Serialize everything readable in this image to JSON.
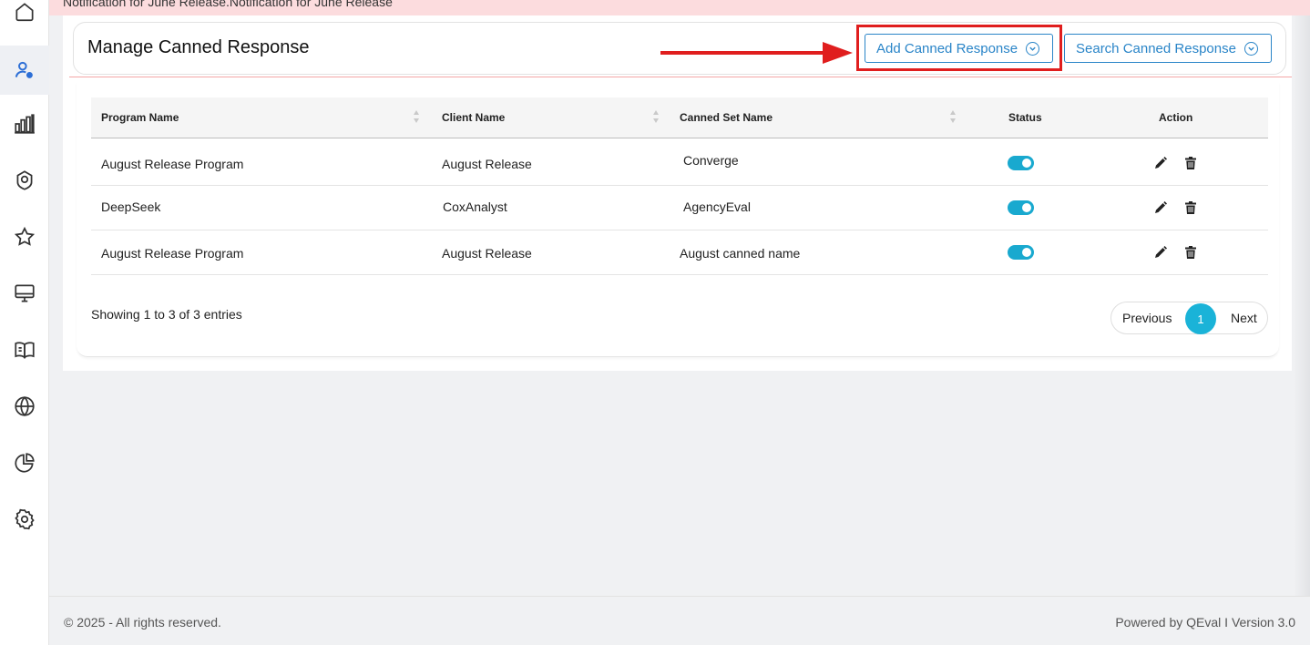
{
  "banner": {
    "text": "Notification for June Release.Notification for June Release"
  },
  "sidebar": {
    "items": [
      {
        "icon": "home-icon"
      },
      {
        "icon": "user-settings-icon",
        "active": true
      },
      {
        "icon": "bar-chart-icon"
      },
      {
        "icon": "badge-icon"
      },
      {
        "icon": "star-icon"
      },
      {
        "icon": "monitor-icon"
      },
      {
        "icon": "book-icon"
      },
      {
        "icon": "globe-icon"
      },
      {
        "icon": "pie-chart-icon"
      },
      {
        "icon": "gear-icon"
      }
    ]
  },
  "header": {
    "title": "Manage Canned Response",
    "add_button": "Add Canned Response",
    "search_button": "Search Canned Response"
  },
  "table": {
    "columns": [
      "Program Name",
      "Client Name",
      "Canned Set Name",
      "Status",
      "Action"
    ],
    "rows": [
      {
        "program": "August Release Program",
        "client": "August Release",
        "canned_set": "Converge",
        "status": "on"
      },
      {
        "program": "DeepSeek",
        "client": "CoxAnalyst",
        "canned_set": "AgencyEval",
        "status": "on"
      },
      {
        "program": "August Release Program",
        "client": "August Release",
        "canned_set": "August canned name",
        "status": "on"
      }
    ]
  },
  "pagination": {
    "info": "Showing 1 to 3 of 3 entries",
    "previous": "Previous",
    "current": "1",
    "next": "Next"
  },
  "footer": {
    "copyright": "© 2025 - All rights reserved.",
    "powered": "Powered by QEval I Version 3.0"
  },
  "colors": {
    "accent": "#2a85c8",
    "toggle_on": "#19a9cf",
    "highlight": "#e01e1e",
    "banner_bg": "#fcdcde"
  }
}
